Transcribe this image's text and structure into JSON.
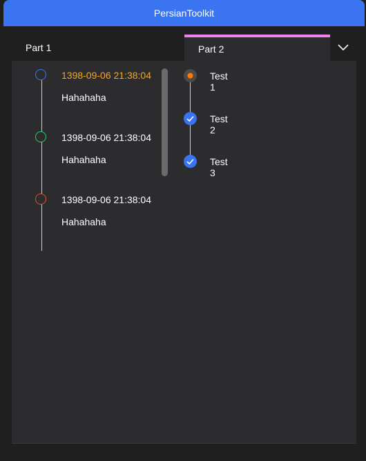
{
  "window": {
    "title": "PersianToolkit"
  },
  "tabs": [
    {
      "label": "Part 1",
      "selected": false
    },
    {
      "label": "Part 2",
      "selected": true
    }
  ],
  "timeline": {
    "items": [
      {
        "time": "1398-09-06 21:38:04",
        "text": "Hahahaha",
        "dot_color": "#3a74f0",
        "time_color": "#f5a623"
      },
      {
        "time": "1398-09-06 21:38:04",
        "text": "Hahahaha",
        "dot_color": "#2ecc71",
        "time_color": "#ffffff"
      },
      {
        "time": "1398-09-06 21:38:04",
        "text": "Hahahaha",
        "dot_color": "#e74c3c",
        "time_color": "#ffffff"
      }
    ]
  },
  "steps": {
    "items": [
      {
        "label": "Test 1",
        "state": "current"
      },
      {
        "label": "Test 2",
        "state": "completed"
      },
      {
        "label": "Test 3",
        "state": "completed"
      }
    ]
  },
  "colors": {
    "accent": "#3a74f0",
    "tab_indicator": "#ee82ee",
    "current_step": "#ff7a00"
  }
}
